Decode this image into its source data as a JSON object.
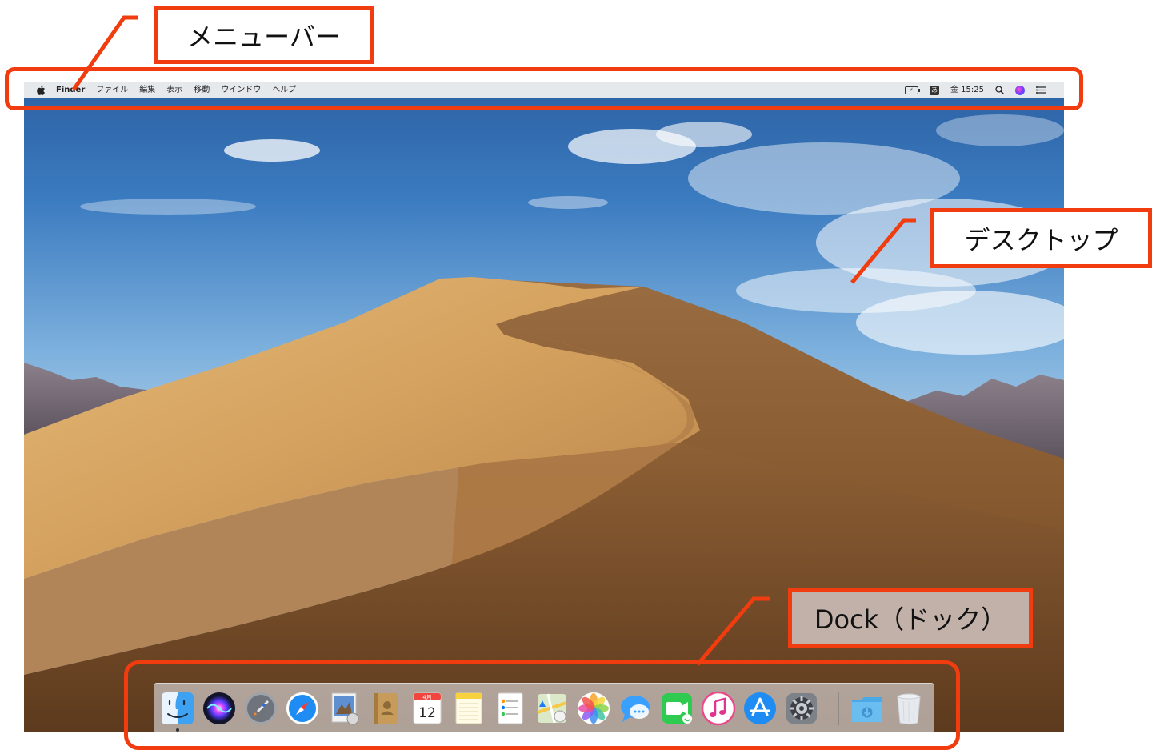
{
  "menubar": {
    "apple_icon": "apple-icon",
    "app_name": "Finder",
    "menus": [
      "ファイル",
      "編集",
      "表示",
      "移動",
      "ウインドウ",
      "ヘルプ"
    ],
    "status": {
      "battery_icon": "battery-charging-icon",
      "input_method_label": "あ",
      "clock": "金 15:25",
      "search_icon": "spotlight-search-icon",
      "siri_icon": "siri-icon",
      "notification_icon": "notification-center-icon"
    }
  },
  "dock": {
    "apps": [
      {
        "name": "Finder",
        "icon": "finder-icon",
        "running": true
      },
      {
        "name": "Siri",
        "icon": "siri-icon"
      },
      {
        "name": "Launchpad",
        "icon": "launchpad-rocket-icon"
      },
      {
        "name": "Safari",
        "icon": "safari-compass-icon"
      },
      {
        "name": "Preview",
        "icon": "preview-icon"
      },
      {
        "name": "Contacts",
        "icon": "contacts-book-icon"
      },
      {
        "name": "Calendar",
        "icon": "calendar-icon",
        "month": "4月",
        "day": "12"
      },
      {
        "name": "Notes",
        "icon": "notes-icon"
      },
      {
        "name": "Reminders",
        "icon": "reminders-icon"
      },
      {
        "name": "Maps",
        "icon": "maps-icon"
      },
      {
        "name": "Photos",
        "icon": "photos-icon"
      },
      {
        "name": "Messages",
        "icon": "messages-icon"
      },
      {
        "name": "FaceTime",
        "icon": "facetime-icon"
      },
      {
        "name": "iTunes",
        "icon": "itunes-icon"
      },
      {
        "name": "App Store",
        "icon": "app-store-icon"
      },
      {
        "name": "System Preferences",
        "icon": "system-preferences-gear-icon"
      }
    ],
    "downloads": {
      "icon": "downloads-folder-icon"
    },
    "trash": {
      "icon": "trash-icon"
    }
  },
  "annotations": {
    "menubar_label": "メニューバー",
    "desktop_label": "デスクトップ",
    "dock_label": "Dock（ドック）"
  },
  "colors": {
    "annotation_red": "#f03c0f",
    "dock_label_bg": "#c1b1a8"
  }
}
